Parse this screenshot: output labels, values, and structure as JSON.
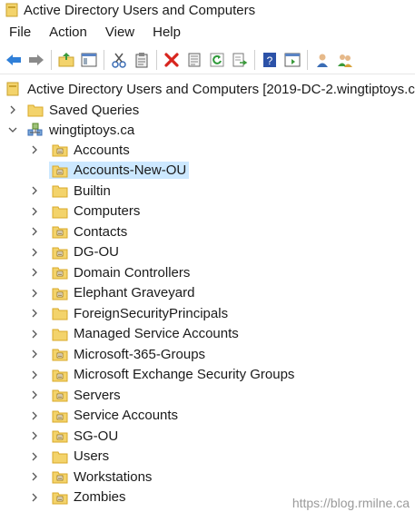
{
  "window": {
    "title": "Active Directory Users and Computers"
  },
  "menu": [
    "File",
    "Action",
    "View",
    "Help"
  ],
  "toolbar": {
    "buttons": [
      "back",
      "forward",
      "up-folder",
      "show-hide-console-tree",
      "cut",
      "copy",
      "delete",
      "properties",
      "refresh",
      "export-list",
      "help",
      "show-hide-action-pane",
      "users",
      "users-group"
    ]
  },
  "tree": {
    "root_label": "Active Directory Users and Computers [2019-DC-2.wingtiptoys.ca",
    "saved_queries": "Saved Queries",
    "domain": "wingtiptoys.ca",
    "selected": "Accounts-New-OU",
    "children": [
      "Accounts",
      "Accounts-New-OU",
      "Builtin",
      "Computers",
      "Contacts",
      "DG-OU",
      "Domain Controllers",
      "Elephant Graveyard",
      "ForeignSecurityPrincipals",
      "Managed Service Accounts",
      "Microsoft-365-Groups",
      "Microsoft Exchange Security Groups",
      "Servers",
      "Service Accounts",
      "SG-OU",
      "Users",
      "Workstations",
      "Zombies"
    ]
  },
  "watermark": "https://blog.rmilne.ca",
  "colors": {
    "selection": "#cce8ff",
    "folder": "#f3d36b",
    "folder_dark": "#d9a928"
  }
}
